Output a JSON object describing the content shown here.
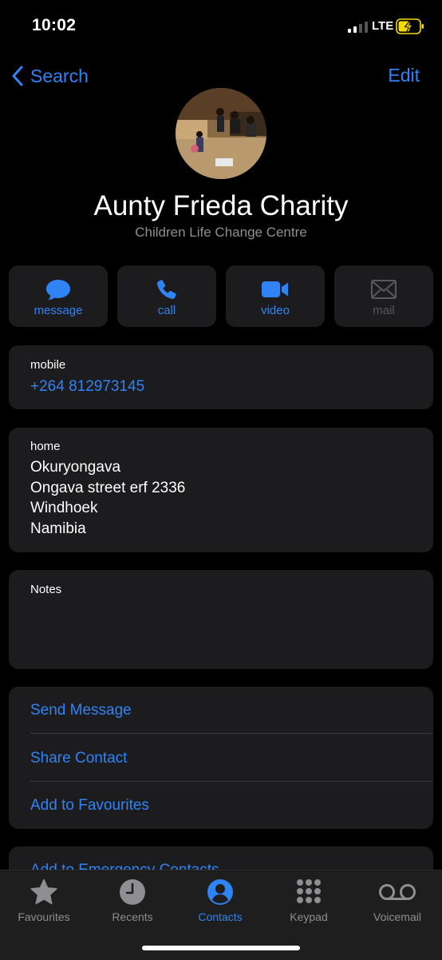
{
  "status_bar": {
    "time": "10:02",
    "network": "LTE"
  },
  "nav": {
    "back_label": "Search",
    "edit_label": "Edit"
  },
  "contact": {
    "name": "Aunty Frieda Charity",
    "subtitle": "Children Life Change Centre"
  },
  "actions": [
    {
      "label": "message",
      "icon": "message-bubble-icon",
      "enabled": true
    },
    {
      "label": "call",
      "icon": "phone-icon",
      "enabled": true
    },
    {
      "label": "video",
      "icon": "video-camera-icon",
      "enabled": true
    },
    {
      "label": "mail",
      "icon": "envelope-icon",
      "enabled": false
    }
  ],
  "phone": {
    "label": "mobile",
    "value": "+264 812973145"
  },
  "address": {
    "label": "home",
    "lines": [
      "Okuryongava",
      "Ongava street erf 2336",
      "Windhoek",
      "Namibia"
    ]
  },
  "notes": {
    "label": "Notes",
    "value": ""
  },
  "links": [
    "Send Message",
    "Share Contact",
    "Add to Favourites"
  ],
  "partial_link": "Add to Emergency Contacts",
  "tabs": [
    {
      "label": "Favourites",
      "icon": "star-icon",
      "active": false
    },
    {
      "label": "Recents",
      "icon": "clock-icon",
      "active": false
    },
    {
      "label": "Contacts",
      "icon": "person-circle-icon",
      "active": true
    },
    {
      "label": "Keypad",
      "icon": "keypad-icon",
      "active": false
    },
    {
      "label": "Voicemail",
      "icon": "voicemail-icon",
      "active": false
    }
  ],
  "colors": {
    "accent": "#2f83f5",
    "card": "#1c1c1e",
    "secondary_text": "#8e8e93",
    "battery_charging": "#f5d90a"
  }
}
